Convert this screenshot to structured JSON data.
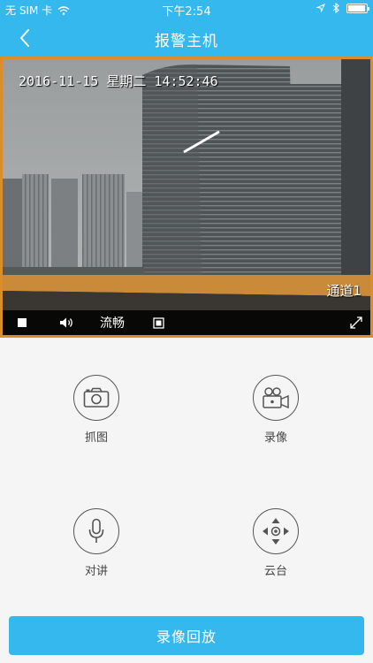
{
  "status_bar": {
    "carrier": "无 SIM 卡",
    "time": "下午2:54"
  },
  "navbar": {
    "title": "报警主机"
  },
  "video": {
    "timestamp": "2016-11-15 星期二 14:52:46",
    "channel": "通道1",
    "controls": {
      "quality_label": "流畅"
    }
  },
  "actions": [
    {
      "label": "抓图",
      "icon": "camera-icon"
    },
    {
      "label": "录像",
      "icon": "video-record-icon"
    },
    {
      "label": "对讲",
      "icon": "microphone-icon"
    },
    {
      "label": "云台",
      "icon": "ptz-direction-icon"
    }
  ],
  "playback_button": {
    "label": "录像回放"
  },
  "colors": {
    "accent": "#35b8ee",
    "video_border": "#d98e2a"
  }
}
